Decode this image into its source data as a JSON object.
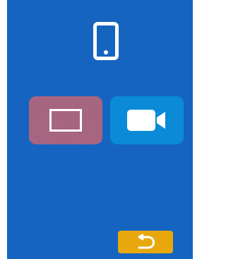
{
  "screen": {
    "background_color": "#1565c0",
    "header_icon": "smartphone-icon"
  },
  "modes": [
    {
      "name": "photo",
      "icon": "rectangle-frame-icon",
      "color": "#a3607c",
      "selected": true
    },
    {
      "name": "video",
      "icon": "video-camera-icon",
      "color": "#0b8ad8",
      "selected": false
    }
  ],
  "footer": {
    "back_icon": "return-arrow-icon",
    "back_color": "#e8a70d"
  }
}
